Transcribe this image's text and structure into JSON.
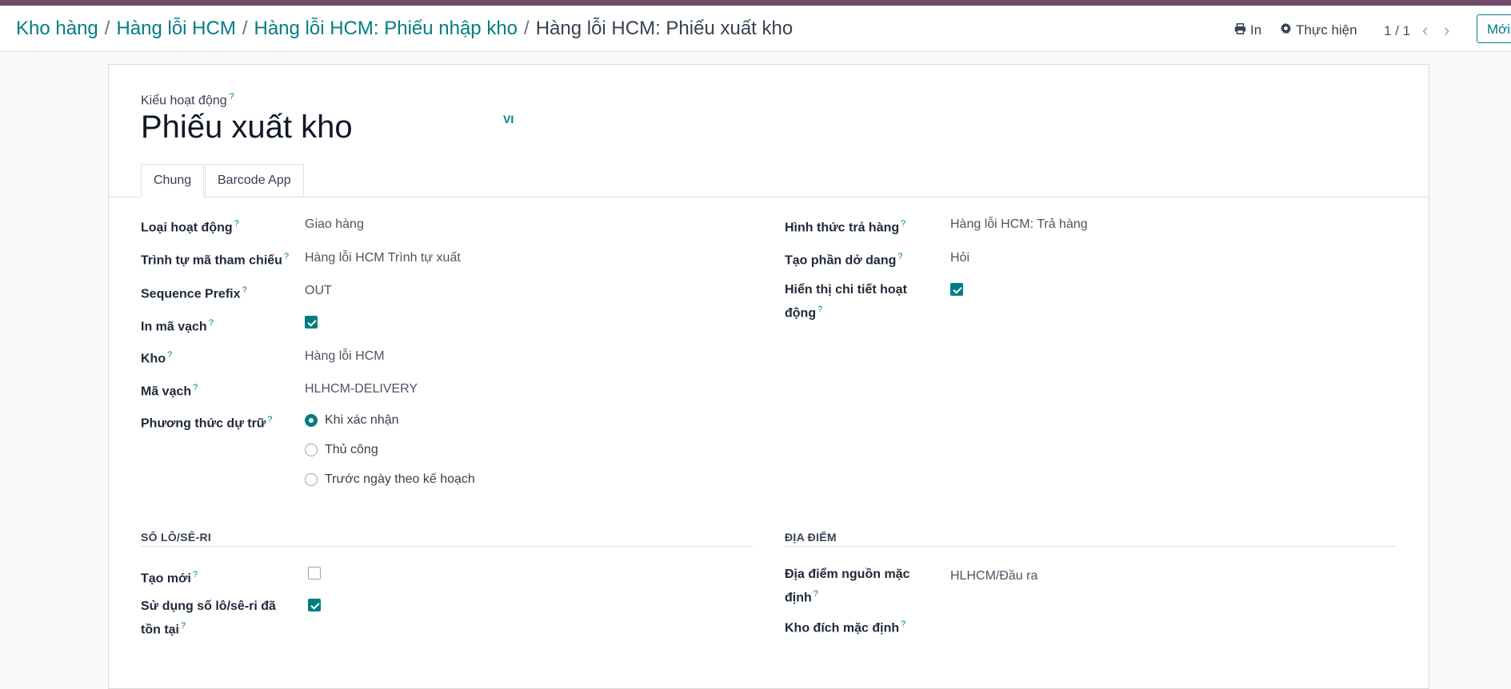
{
  "breadcrumb": {
    "items": [
      "Kho hàng",
      "Hàng lỗi HCM",
      "Hàng lỗi HCM: Phiếu nhập kho"
    ],
    "current": "Hàng lỗi HCM: Phiếu xuất kho",
    "separator": "/"
  },
  "toolbar": {
    "print_label": "In",
    "action_label": "Thực hiện",
    "pager": "1 / 1",
    "new_label": "Mới"
  },
  "form": {
    "type_label": "Kiểu hoạt động",
    "title": "Phiếu xuất kho",
    "lang": "VI",
    "help": "?"
  },
  "tabs": [
    {
      "label": "Chung",
      "active": true
    },
    {
      "label": "Barcode App",
      "active": false
    }
  ],
  "left": {
    "operation_type": {
      "label": "Loại hoạt động",
      "value": "Giao hàng"
    },
    "sequence": {
      "label": "Trình tự mã tham chiếu",
      "value": "Hàng lỗi HCM Trình tự xuất"
    },
    "prefix": {
      "label": "Sequence Prefix",
      "value": "OUT"
    },
    "print_barcode": {
      "label": "In mã vạch",
      "checked": true
    },
    "warehouse": {
      "label": "Kho",
      "value": "Hàng lỗi HCM"
    },
    "barcode": {
      "label": "Mã vạch",
      "value": "HLHCM-DELIVERY"
    },
    "reservation": {
      "label": "Phương thức dự trữ",
      "options": [
        "Khi xác nhận",
        "Thủ công",
        "Trước ngày theo kế hoạch"
      ],
      "selected": 0
    }
  },
  "right": {
    "return_type": {
      "label": "Hình thức trả hàng",
      "value": "Hàng lỗi HCM: Trả hàng"
    },
    "backorder": {
      "label": "Tạo phần dở dang",
      "value": "Hỏi"
    },
    "show_ops": {
      "label_line1": "Hiển thị chi tiết hoạt",
      "label_line2": "động",
      "checked": true
    }
  },
  "lots": {
    "heading": "SỐ LÔ/SÊ-RI",
    "create_new": {
      "label": "Tạo mới",
      "checked": false
    },
    "use_existing": {
      "label_line1": "Sử dụng số lô/sê-ri đã",
      "label_line2": "tồn tại",
      "checked": true
    }
  },
  "locations": {
    "heading": "ĐỊA ĐIỂM",
    "src": {
      "label_line1": "Địa điểm nguồn mặc",
      "label_line2": "định",
      "value": "HLHCM/Đầu ra"
    },
    "dest": {
      "label": "Kho đích mặc định",
      "value": ""
    }
  },
  "colors": {
    "brand": "#714B67",
    "accent": "#017e84"
  },
  "icons": {
    "print": "printer-icon",
    "gear": "gear-icon",
    "prev": "chevron-left-icon",
    "next": "chevron-right-icon"
  }
}
